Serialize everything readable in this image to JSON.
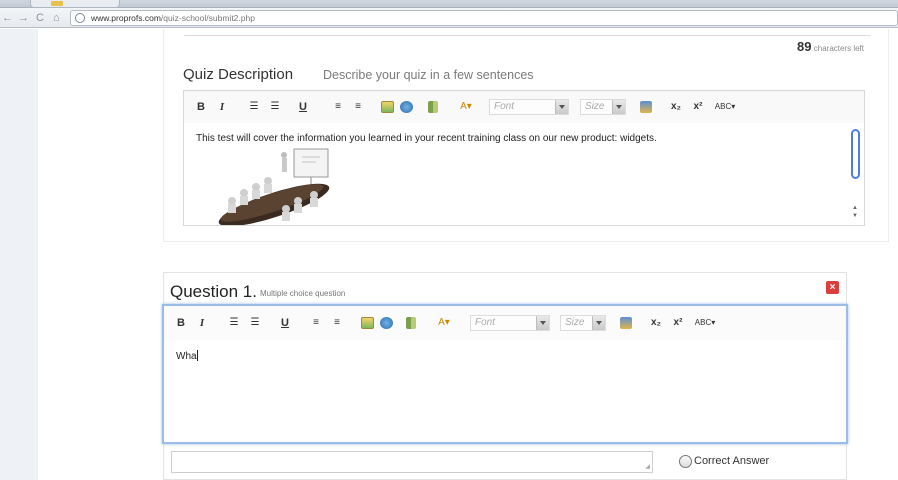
{
  "browser": {
    "url_domain": "www.proprofs.com",
    "url_path": "/quiz-school/submit2.php",
    "back_glyph": "←",
    "forward_glyph": "→",
    "reload_glyph": "C",
    "home_glyph": "⌂"
  },
  "description_section": {
    "char_count": "89",
    "char_count_suffix": "characters left",
    "title": "Quiz Description",
    "hint": "Describe your quiz in a few sentences",
    "content": "This test will cover the information you learned in your recent training class on our new product: widgets.",
    "toolbar": {
      "bold": "B",
      "italic": "I",
      "underline": "U",
      "font_placeholder": "Font",
      "size_placeholder": "Size",
      "subscript": "x₂",
      "superscript": "x²",
      "spellcheck": "ABC▾",
      "text_color": "A▾"
    }
  },
  "question": {
    "title_word": "Question",
    "number": "1.",
    "type_label": "Multiple choice question",
    "close_glyph": "×",
    "typed_text": "Wha",
    "correct_answer_label": "Correct Answer"
  },
  "colors": {
    "focus_border": "#9bbce6",
    "close_button": "#d9403b",
    "scroll_thumb": "#4c7fdc"
  }
}
